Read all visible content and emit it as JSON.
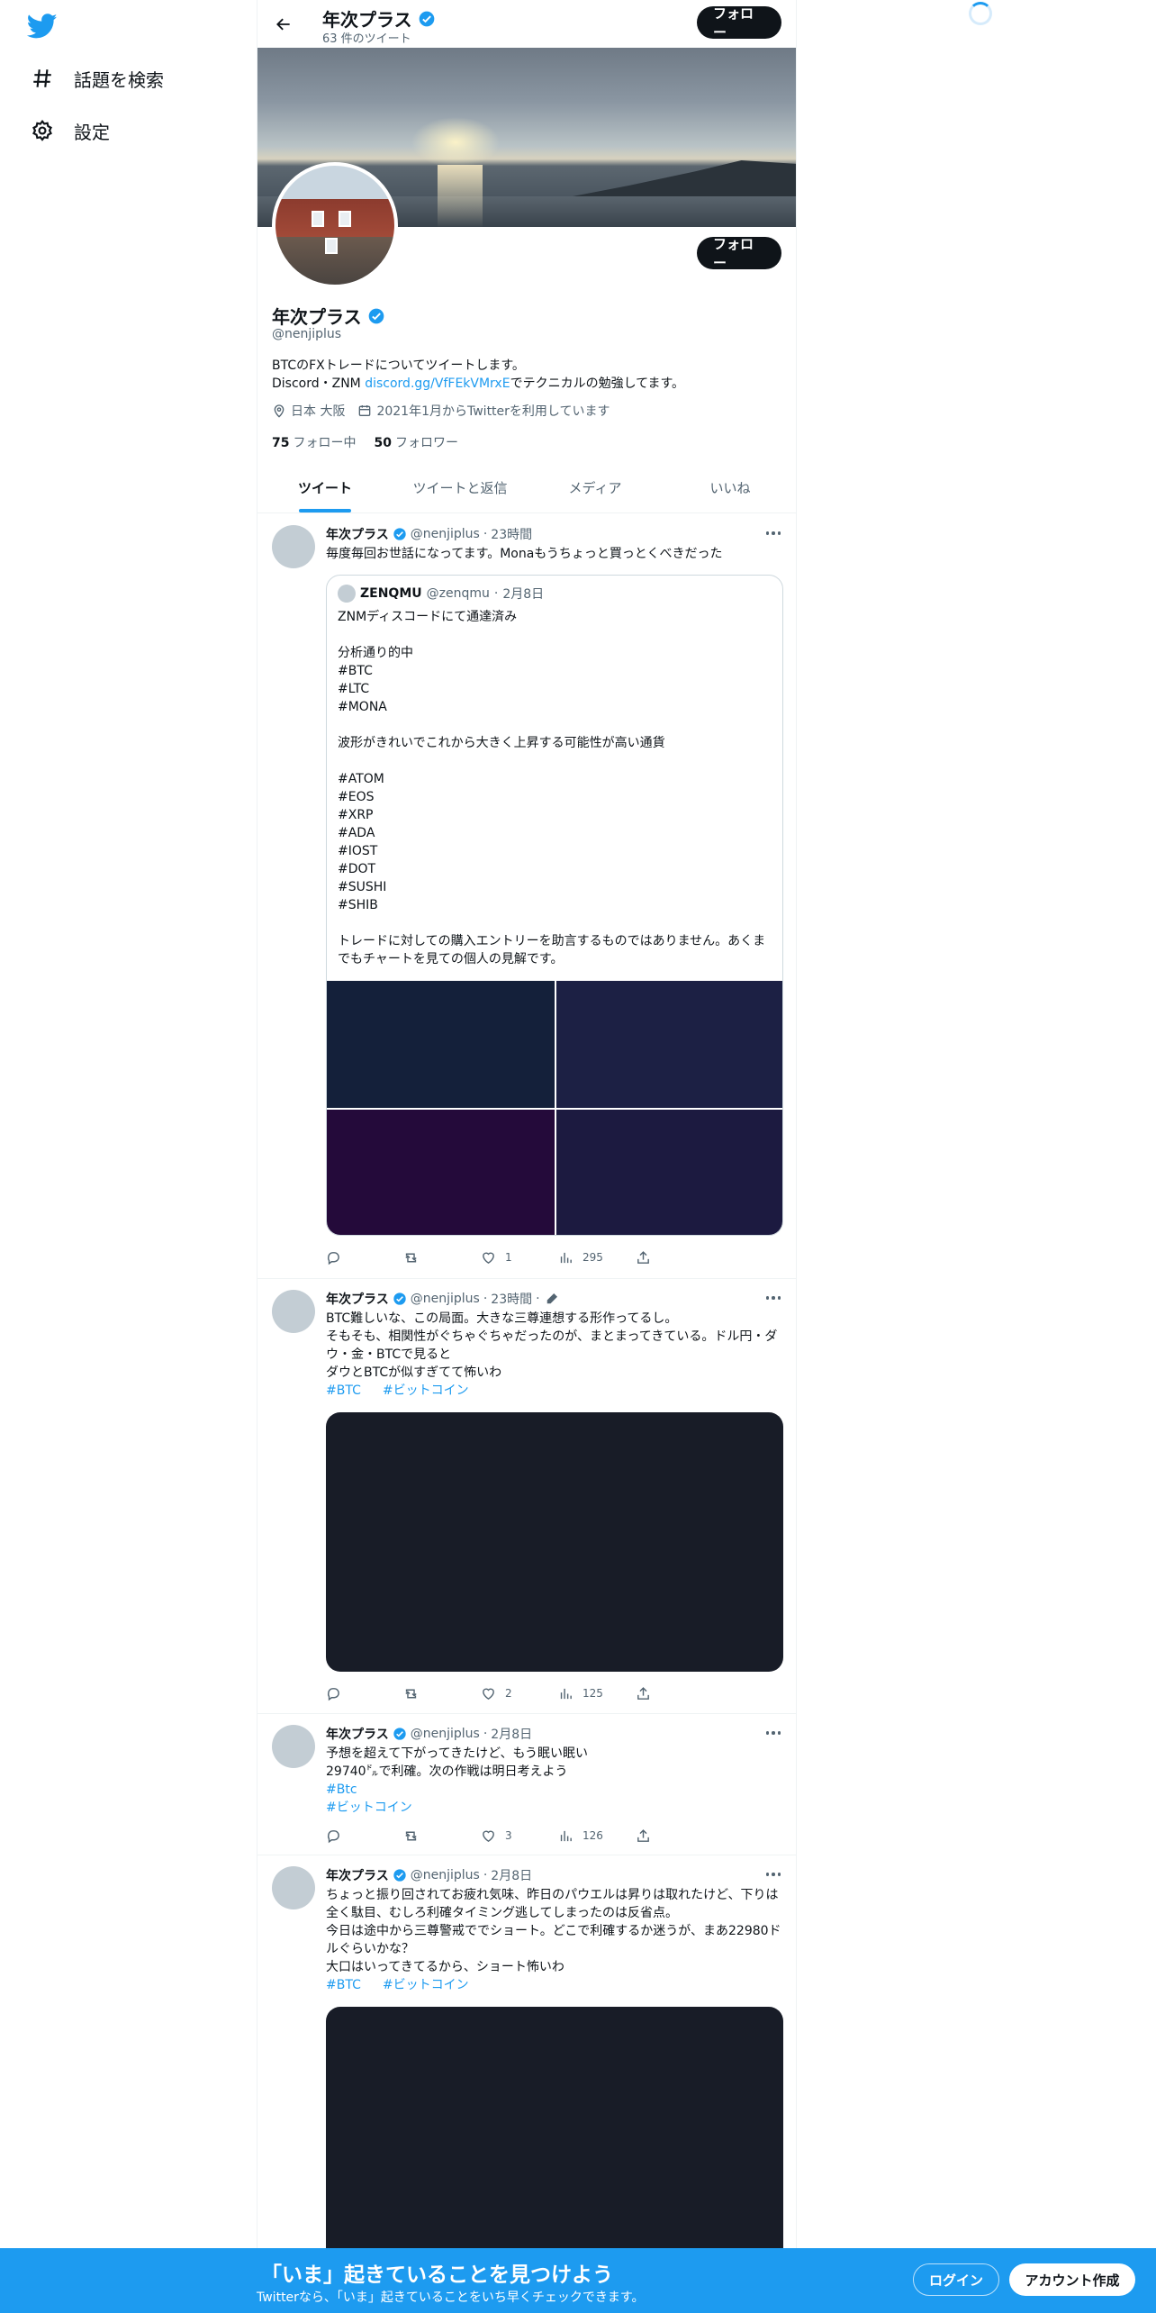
{
  "nav": {
    "explore_label": "話題を検索",
    "settings_label": "設定"
  },
  "header": {
    "name": "年次プラス",
    "tweet_count": "63 件のツイート",
    "follow_label": "フォロー"
  },
  "profile": {
    "name": "年次プラス",
    "handle": "@nenjiplus",
    "bio_line1": "BTCのFXトレードについてツイートします。",
    "bio_line2_prefix": "Discord・ZNM ",
    "bio_link": "discord.gg/VfFEkVMrxE",
    "bio_line2_suffix": "でテクニカルの勉強してます。",
    "location": "日本 大阪",
    "joined": "2021年1月からTwitterを利用しています",
    "following_count": "75",
    "following_label": "フォロー中",
    "followers_count": "50",
    "followers_label": "フォロワー",
    "follow_label": "フォロー"
  },
  "tabs": [
    "ツイート",
    "ツイートと返信",
    "メディア",
    "いいね"
  ],
  "tweets": [
    {
      "name": "年次プラス",
      "handle": "@nenjiplus",
      "time": "23時間",
      "text": "毎度毎回お世話になってます。Monaもうちょっと買っとくべきだった",
      "quote": {
        "name": "ZENQMU",
        "handle": "@zenqmu",
        "time": "2月8日",
        "text": "ZNMディスコードにて通達済み\n\n分析通り的中\n#BTC\n#LTC\n#MONA\n\n波形がきれいでこれから大きく上昇する可能性が高い通貨\n\n#ATOM\n#EOS\n#XRP\n#ADA\n#IOST\n#DOT\n#SUSHI\n#SHIB\n\nトレードに対しての購入エントリーを助言するものではありません。あくまでもチャートを見ての個人の見解です。",
        "image_colors": [
          "#14203a",
          "#1c2044",
          "#240a3a",
          "#1c1a40"
        ]
      },
      "likes": "1",
      "views": "295"
    },
    {
      "name": "年次プラス",
      "handle": "@nenjiplus",
      "time": "23時間",
      "text": "BTC難しいな、この局面。大きな三尊連想する形作ってるし。\nそもそも、相関性がぐちゃぐちゃだったのが、まとまってきている。ドル円・ダウ・金・BTCで見ると\nダウとBTCが似すぎてて怖いわ",
      "hashtags": [
        "#BTC",
        "#ビットコイン"
      ],
      "likes": "2",
      "views": "125"
    },
    {
      "name": "年次プラス",
      "handle": "@nenjiplus",
      "time": "2月8日",
      "text": "予想を超えて下がってきたけど、もう眠い眠い\n29740㌦で利確。次の作戦は明日考えよう",
      "hashtags": [
        "#Btc",
        "#ビットコイン"
      ],
      "likes": "3",
      "views": "126"
    },
    {
      "name": "年次プラス",
      "handle": "@nenjiplus",
      "time": "2月8日",
      "text": "ちょっと振り回されてお疲れ気味、昨日のパウエルは昇りは取れたけど、下りは全く駄目、むしろ利確タイミング逃してしまったのは反省点。\n今日は途中から三尊警戒ででショート。どこで利確するか迷うが、まあ22980ドルぐらいかな？\n大口はいってきてるから、ショート怖いわ",
      "hashtags": [
        "#BTC",
        "#ビットコイン"
      ]
    }
  ],
  "bottom_bar": {
    "title": "「いま」起きていることを見つけよう",
    "subtitle": "Twitterなら、「いま」起きていることをいち早くチェックできます。",
    "login_label": "ログイン",
    "signup_label": "アカウント作成"
  },
  "colors": {
    "accent": "#1d9bf0",
    "text": "#0f1419",
    "muted": "#536471",
    "border": "#eff3f4"
  }
}
